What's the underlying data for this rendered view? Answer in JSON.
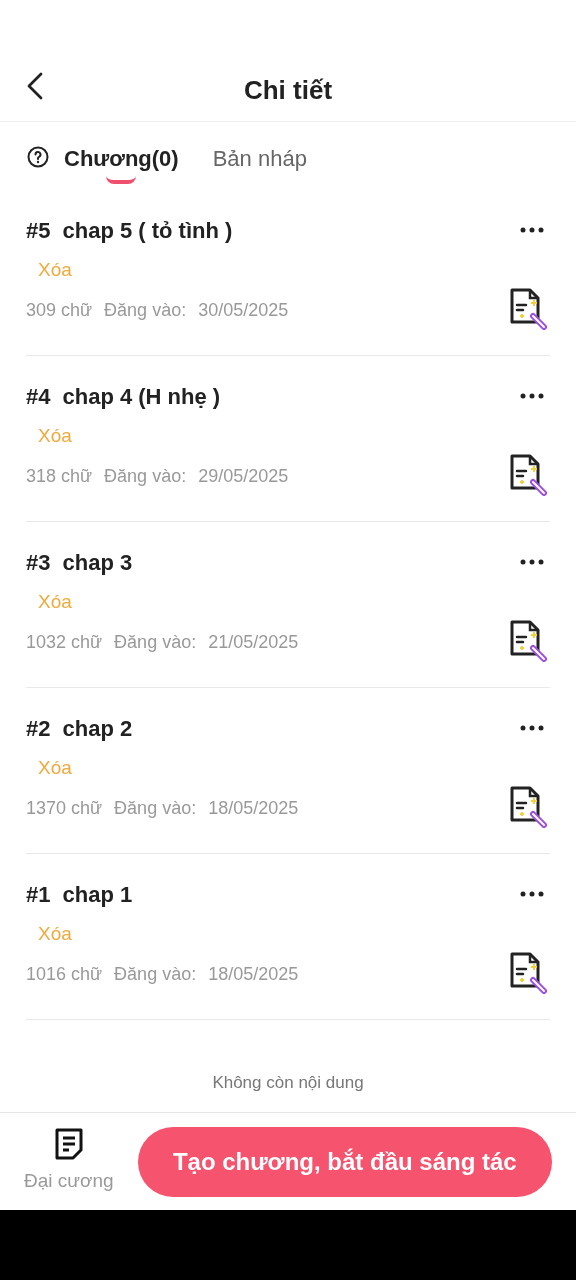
{
  "header": {
    "title": "Chi tiết"
  },
  "tabs": [
    {
      "label": "Chương(0)",
      "selected": true
    },
    {
      "label": "Bản nháp",
      "selected": false
    }
  ],
  "chapters": [
    {
      "number": "#5",
      "title": "chap 5 ( tỏ tình )",
      "action": "Xóa",
      "words": "309 chữ",
      "posted_label": "Đăng vào:",
      "date": "30/05/2025"
    },
    {
      "number": "#4",
      "title": "chap 4 (H nhẹ )",
      "action": "Xóa",
      "words": "318 chữ",
      "posted_label": "Đăng vào:",
      "date": "29/05/2025"
    },
    {
      "number": "#3",
      "title": "chap 3",
      "action": "Xóa",
      "words": "1032 chữ",
      "posted_label": "Đăng vào:",
      "date": "21/05/2025"
    },
    {
      "number": "#2",
      "title": "chap 2",
      "action": "Xóa",
      "words": "1370 chữ",
      "posted_label": "Đăng vào:",
      "date": "18/05/2025"
    },
    {
      "number": "#1",
      "title": "chap 1",
      "action": "Xóa",
      "words": "1016 chữ",
      "posted_label": "Đăng vào:",
      "date": "18/05/2025"
    }
  ],
  "end_note": "Không còn nội dung",
  "bottom_bar": {
    "outline_label": "Đại cương",
    "create_button": "Tạo chương, bắt đầu sáng tác"
  }
}
